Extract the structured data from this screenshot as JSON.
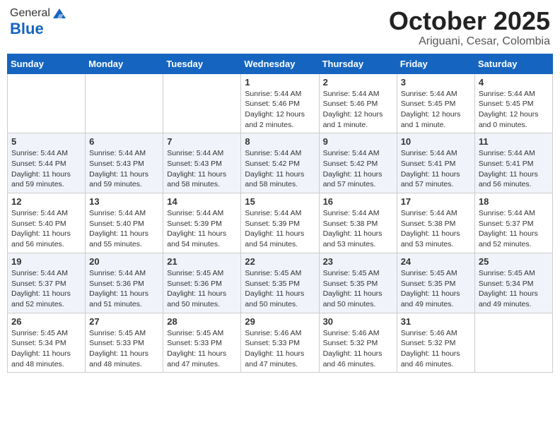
{
  "header": {
    "logo_general": "General",
    "logo_blue": "Blue",
    "month_title": "October 2025",
    "location": "Ariguani, Cesar, Colombia"
  },
  "days_of_week": [
    "Sunday",
    "Monday",
    "Tuesday",
    "Wednesday",
    "Thursday",
    "Friday",
    "Saturday"
  ],
  "weeks": [
    [
      {
        "day": "",
        "info": ""
      },
      {
        "day": "",
        "info": ""
      },
      {
        "day": "",
        "info": ""
      },
      {
        "day": "1",
        "info": "Sunrise: 5:44 AM\nSunset: 5:46 PM\nDaylight: 12 hours\nand 2 minutes."
      },
      {
        "day": "2",
        "info": "Sunrise: 5:44 AM\nSunset: 5:46 PM\nDaylight: 12 hours\nand 1 minute."
      },
      {
        "day": "3",
        "info": "Sunrise: 5:44 AM\nSunset: 5:45 PM\nDaylight: 12 hours\nand 1 minute."
      },
      {
        "day": "4",
        "info": "Sunrise: 5:44 AM\nSunset: 5:45 PM\nDaylight: 12 hours\nand 0 minutes."
      }
    ],
    [
      {
        "day": "5",
        "info": "Sunrise: 5:44 AM\nSunset: 5:44 PM\nDaylight: 11 hours\nand 59 minutes."
      },
      {
        "day": "6",
        "info": "Sunrise: 5:44 AM\nSunset: 5:43 PM\nDaylight: 11 hours\nand 59 minutes."
      },
      {
        "day": "7",
        "info": "Sunrise: 5:44 AM\nSunset: 5:43 PM\nDaylight: 11 hours\nand 58 minutes."
      },
      {
        "day": "8",
        "info": "Sunrise: 5:44 AM\nSunset: 5:42 PM\nDaylight: 11 hours\nand 58 minutes."
      },
      {
        "day": "9",
        "info": "Sunrise: 5:44 AM\nSunset: 5:42 PM\nDaylight: 11 hours\nand 57 minutes."
      },
      {
        "day": "10",
        "info": "Sunrise: 5:44 AM\nSunset: 5:41 PM\nDaylight: 11 hours\nand 57 minutes."
      },
      {
        "day": "11",
        "info": "Sunrise: 5:44 AM\nSunset: 5:41 PM\nDaylight: 11 hours\nand 56 minutes."
      }
    ],
    [
      {
        "day": "12",
        "info": "Sunrise: 5:44 AM\nSunset: 5:40 PM\nDaylight: 11 hours\nand 56 minutes."
      },
      {
        "day": "13",
        "info": "Sunrise: 5:44 AM\nSunset: 5:40 PM\nDaylight: 11 hours\nand 55 minutes."
      },
      {
        "day": "14",
        "info": "Sunrise: 5:44 AM\nSunset: 5:39 PM\nDaylight: 11 hours\nand 54 minutes."
      },
      {
        "day": "15",
        "info": "Sunrise: 5:44 AM\nSunset: 5:39 PM\nDaylight: 11 hours\nand 54 minutes."
      },
      {
        "day": "16",
        "info": "Sunrise: 5:44 AM\nSunset: 5:38 PM\nDaylight: 11 hours\nand 53 minutes."
      },
      {
        "day": "17",
        "info": "Sunrise: 5:44 AM\nSunset: 5:38 PM\nDaylight: 11 hours\nand 53 minutes."
      },
      {
        "day": "18",
        "info": "Sunrise: 5:44 AM\nSunset: 5:37 PM\nDaylight: 11 hours\nand 52 minutes."
      }
    ],
    [
      {
        "day": "19",
        "info": "Sunrise: 5:44 AM\nSunset: 5:37 PM\nDaylight: 11 hours\nand 52 minutes."
      },
      {
        "day": "20",
        "info": "Sunrise: 5:44 AM\nSunset: 5:36 PM\nDaylight: 11 hours\nand 51 minutes."
      },
      {
        "day": "21",
        "info": "Sunrise: 5:45 AM\nSunset: 5:36 PM\nDaylight: 11 hours\nand 50 minutes."
      },
      {
        "day": "22",
        "info": "Sunrise: 5:45 AM\nSunset: 5:35 PM\nDaylight: 11 hours\nand 50 minutes."
      },
      {
        "day": "23",
        "info": "Sunrise: 5:45 AM\nSunset: 5:35 PM\nDaylight: 11 hours\nand 50 minutes."
      },
      {
        "day": "24",
        "info": "Sunrise: 5:45 AM\nSunset: 5:35 PM\nDaylight: 11 hours\nand 49 minutes."
      },
      {
        "day": "25",
        "info": "Sunrise: 5:45 AM\nSunset: 5:34 PM\nDaylight: 11 hours\nand 49 minutes."
      }
    ],
    [
      {
        "day": "26",
        "info": "Sunrise: 5:45 AM\nSunset: 5:34 PM\nDaylight: 11 hours\nand 48 minutes."
      },
      {
        "day": "27",
        "info": "Sunrise: 5:45 AM\nSunset: 5:33 PM\nDaylight: 11 hours\nand 48 minutes."
      },
      {
        "day": "28",
        "info": "Sunrise: 5:45 AM\nSunset: 5:33 PM\nDaylight: 11 hours\nand 47 minutes."
      },
      {
        "day": "29",
        "info": "Sunrise: 5:46 AM\nSunset: 5:33 PM\nDaylight: 11 hours\nand 47 minutes."
      },
      {
        "day": "30",
        "info": "Sunrise: 5:46 AM\nSunset: 5:32 PM\nDaylight: 11 hours\nand 46 minutes."
      },
      {
        "day": "31",
        "info": "Sunrise: 5:46 AM\nSunset: 5:32 PM\nDaylight: 11 hours\nand 46 minutes."
      },
      {
        "day": "",
        "info": ""
      }
    ]
  ]
}
